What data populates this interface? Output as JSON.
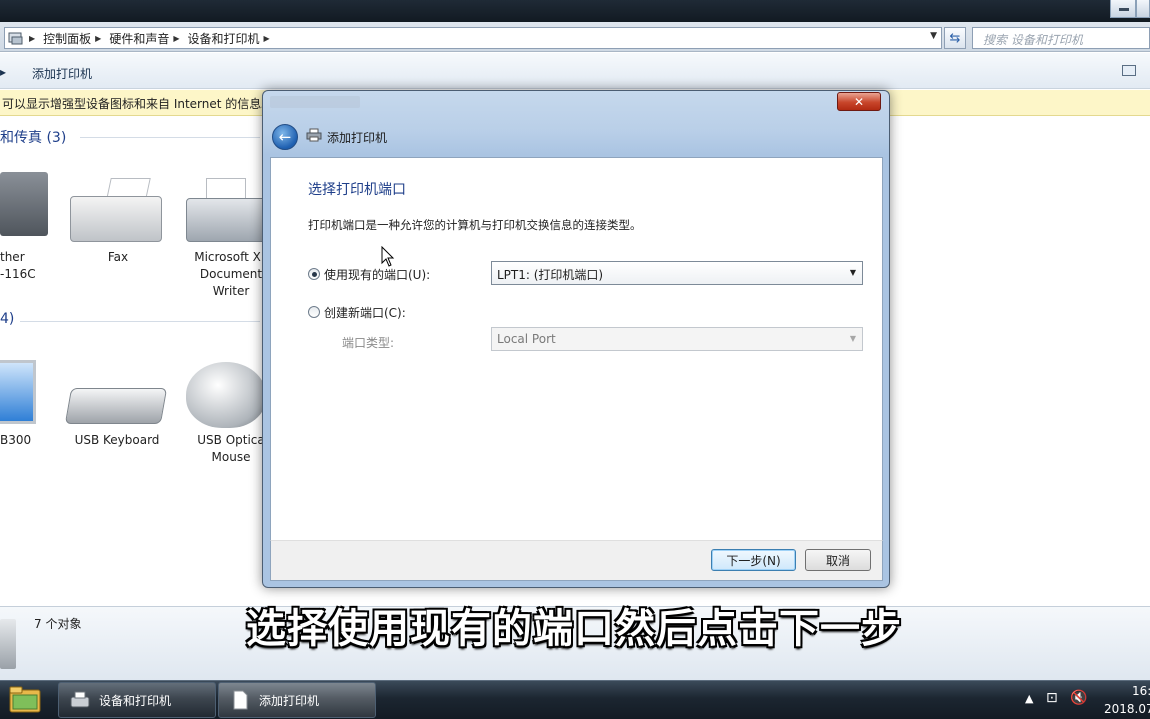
{
  "explorer": {
    "breadcrumbs": [
      "控制面板",
      "硬件和声音",
      "设备和打印机"
    ],
    "search_placeholder": "搜索 设备和打印机",
    "toolbar_add_printer": "添加打印机",
    "infobar_text": "可以显示增强型设备图标和来自 Internet 的信息。",
    "group_printers": "和传真 (3)",
    "group_devices": "4)",
    "devices_printers": [
      {
        "label_lines": [
          "ther",
          "-116C"
        ],
        "icon": "printer-icon"
      },
      {
        "label_lines": [
          "Fax"
        ],
        "icon": "fax-icon"
      },
      {
        "label_lines": [
          "Microsoft XF",
          "Document",
          "Writer"
        ],
        "icon": "xps-printer-icon"
      }
    ],
    "devices_other": [
      {
        "label_lines": [
          "B300"
        ],
        "icon": "monitor-icon"
      },
      {
        "label_lines": [
          "USB Keyboard"
        ],
        "icon": "keyboard-icon"
      },
      {
        "label_lines": [
          "USB Optica",
          "Mouse"
        ],
        "icon": "mouse-icon"
      }
    ],
    "status_count": "7 个对象"
  },
  "dialog": {
    "nav_title": "添加打印机",
    "close_glyph": "✕",
    "heading": "选择打印机端口",
    "description": "打印机端口是一种允许您的计算机与打印机交换信息的连接类型。",
    "option_existing_label": "使用现有的端口(U):",
    "option_existing_selected": true,
    "existing_port_value": "LPT1: (打印机端口)",
    "option_new_label": "创建新端口(C):",
    "port_type_label": "端口类型:",
    "port_type_value": "Local Port",
    "next_button": "下一步(N)",
    "cancel_button": "取消"
  },
  "subtitle": "选择使用现有的端口然后点击下一步",
  "taskbar": {
    "tasks": [
      {
        "label": "设备和打印机",
        "icon": "devices-printers-icon"
      },
      {
        "label": "添加打印机",
        "icon": "document-icon"
      }
    ],
    "time": "16:",
    "date": "2018.07"
  },
  "colors": {
    "accent_heading": "#1f3f8a",
    "infobar": "#fdf6c8",
    "close_button": "#c8462b",
    "taskbar": "#1c2631"
  }
}
